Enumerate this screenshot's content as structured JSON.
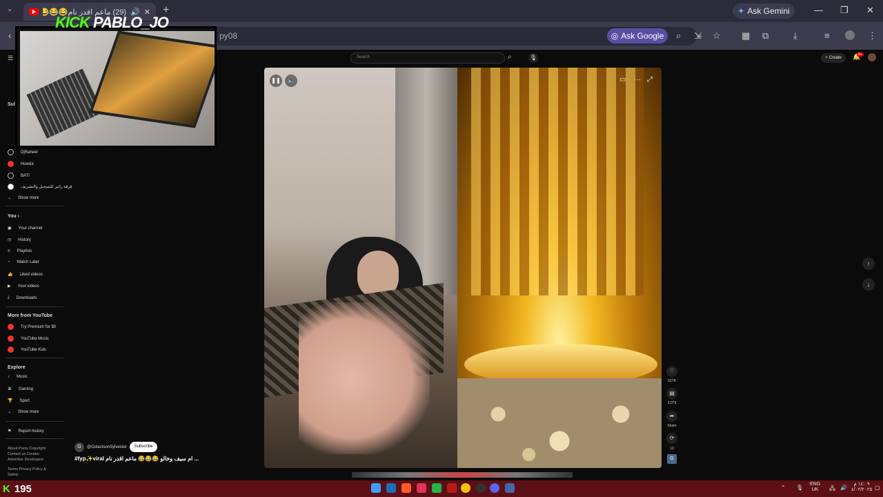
{
  "browser": {
    "tab_title": "(29) ماعم اقدر نام😂😂😂",
    "url": "py08",
    "ask_gemini": "Ask Gemini",
    "ask_google": "Ask Google"
  },
  "stream_overlay": {
    "brand": "KICK",
    "streamer": "PABLO_JO",
    "viewer_count": "195",
    "viewer_logo": "K"
  },
  "youtube": {
    "search_placeholder": "Search",
    "create_label": "Create",
    "notif_count": "9+",
    "sidebar": {
      "subs_header": "Sul",
      "subs": [
        "DjRaheel",
        "Howda",
        "BATI",
        "قرفة راتيز للتسجيل والتشريف"
      ],
      "show_more_1": "Show more",
      "you_header": "You",
      "you_items": [
        "Your channel",
        "History",
        "Playlists",
        "Watch Later",
        "Liked videos",
        "Your videos",
        "Downloads"
      ],
      "more_header": "More from YouTube",
      "more_items": [
        "Try Premium for $0",
        "YouTube Music",
        "YouTube Kids"
      ],
      "explore_header": "Explore",
      "explore_items": [
        "Music",
        "Gaming",
        "Sport"
      ],
      "show_more_2": "Show more",
      "report": "Report history",
      "footer1": "About Press Copyright Contact us Creator Advertise Developers",
      "footer2": "Terms Privacy Policy & Safety"
    },
    "short": {
      "likes": "627K",
      "comments": "3,079",
      "share": "Share",
      "remix": "10",
      "channel_initial": "G",
      "channel": "@GolactsonSylvester",
      "subscribe": "Subscribe",
      "caption": "#fyp✨viral ام سيف وخالو 😂😂😂 ماعم اقدر نام ..."
    }
  },
  "taskbar": {
    "lang": "ENG",
    "region": "UK",
    "time": "١٤:٠٩ م",
    "date": "٤/٠٢/٢٠٢٥"
  }
}
